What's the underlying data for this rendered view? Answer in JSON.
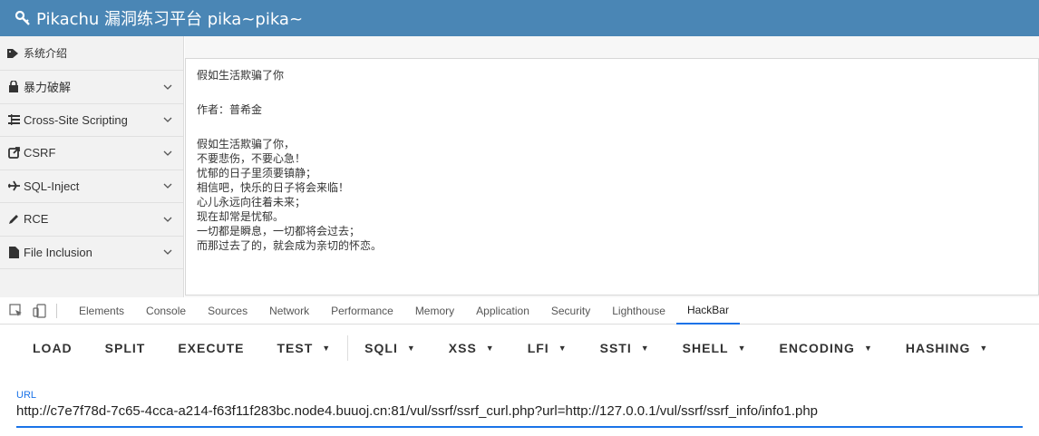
{
  "navbar": {
    "title": "Pikachu 漏洞练习平台 pika~pika~",
    "icon": "key-icon"
  },
  "sidebar": {
    "items": [
      {
        "label": "系统介绍",
        "icon": "tags-icon",
        "has_chevron": false
      },
      {
        "label": "暴力破解",
        "icon": "lock-icon",
        "has_chevron": true
      },
      {
        "label": "Cross-Site Scripting",
        "icon": "list-icon",
        "has_chevron": true
      },
      {
        "label": "CSRF",
        "icon": "share-icon",
        "has_chevron": true
      },
      {
        "label": "SQL-Inject",
        "icon": "plane-icon",
        "has_chevron": true
      },
      {
        "label": "RCE",
        "icon": "pencil-icon",
        "has_chevron": true
      },
      {
        "label": "File Inclusion",
        "icon": "file-icon",
        "has_chevron": true
      }
    ]
  },
  "main": {
    "poem_title": "假如生活欺骗了你",
    "author": "作者：普希金",
    "lines": [
      "假如生活欺骗了你，",
      "不要悲伤，不要心急！",
      "忧郁的日子里须要镇静；",
      "相信吧，快乐的日子将会来临！",
      "心儿永远向往着未来；",
      "现在却常是忧郁。",
      "一切都是瞬息，一切都将会过去；",
      "而那过去了的，就会成为亲切的怀恋。"
    ]
  },
  "devtools": {
    "tabs": [
      "Elements",
      "Console",
      "Sources",
      "Network",
      "Performance",
      "Memory",
      "Application",
      "Security",
      "Lighthouse",
      "HackBar"
    ],
    "active_tab": "HackBar"
  },
  "hackbar": {
    "buttons": [
      {
        "label": "LOAD",
        "dropdown": false
      },
      {
        "label": "SPLIT",
        "dropdown": false
      },
      {
        "label": "EXECUTE",
        "dropdown": false
      },
      {
        "label": "TEST",
        "dropdown": true
      },
      {
        "label": "SQLI",
        "dropdown": true
      },
      {
        "label": "XSS",
        "dropdown": true
      },
      {
        "label": "LFI",
        "dropdown": true
      },
      {
        "label": "SSTI",
        "dropdown": true
      },
      {
        "label": "SHELL",
        "dropdown": true
      },
      {
        "label": "ENCODING",
        "dropdown": true
      },
      {
        "label": "HASHING",
        "dropdown": true
      }
    ],
    "url_label": "URL",
    "url_value": "http://c7e7f78d-7c65-4cca-a214-f63f11f283bc.node4.buuoj.cn:81/vul/ssrf/ssrf_curl.php?url=http://127.0.0.1/vul/ssrf/ssrf_info/info1.php"
  },
  "colors": {
    "navbar": "#4a86b5",
    "accent": "#1a73e8"
  }
}
